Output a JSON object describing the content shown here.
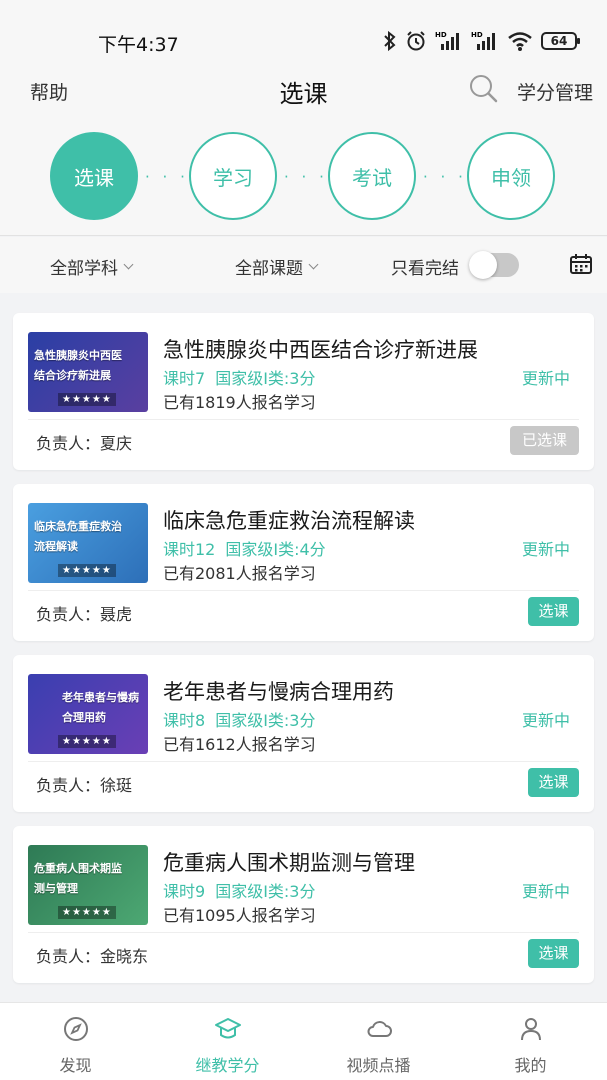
{
  "status_bar": {
    "time": "下午4:37",
    "battery": "64"
  },
  "header": {
    "help": "帮助",
    "title": "选课",
    "credit_management": "学分管理"
  },
  "steps": [
    "选课",
    "学习",
    "考试",
    "申领"
  ],
  "step_separator": "· · ·",
  "filters": {
    "subject": "全部学科",
    "topic": "全部课题",
    "finished_only": "只看完结",
    "finished_only_on": false
  },
  "courses": [
    {
      "title": "急性胰腺炎中西医结合诊疗新进展",
      "hours": "课时7",
      "credit": "国家级I类:3分",
      "enrolled": "已有1819人报名学习",
      "status": "更新中",
      "owner": "负责人：夏庆",
      "action": "已选课",
      "thumb_text": "急性胰腺炎中西医结合诊疗新进展",
      "thumb_stars": "★★★★★",
      "thumb_color": "#2a3fa5"
    },
    {
      "title": "临床急危重症救治流程解读",
      "hours": "课时12",
      "credit": "国家级I类:4分",
      "enrolled": "已有2081人报名学习",
      "status": "更新中",
      "owner": "负责人：聂虎",
      "action": "选课",
      "thumb_text": "临床急危重症救治流程解读",
      "thumb_stars": "★★★★★",
      "thumb_color": "#3d8fd6"
    },
    {
      "title": "老年患者与慢病合理用药",
      "hours": "课时8",
      "credit": "国家级I类:3分",
      "enrolled": "已有1612人报名学习",
      "status": "更新中",
      "owner": "负责人：徐珽",
      "action": "选课",
      "thumb_text": "老年患者与慢病合理用药",
      "thumb_stars": "★★★★★",
      "thumb_color": "#3a3fb0"
    },
    {
      "title": "危重病人围术期监测与管理",
      "hours": "课时9",
      "credit": "国家级I类:3分",
      "enrolled": "已有1095人报名学习",
      "status": "更新中",
      "owner": "负责人：金晓东",
      "action": "选课",
      "thumb_text": "危重病人围术期监测与管理",
      "thumb_stars": "★★★★★",
      "thumb_color": "#2e7a55"
    }
  ],
  "tabs": [
    {
      "label": "发现",
      "icon": "compass-icon"
    },
    {
      "label": "继教学分",
      "icon": "graduation-cap-icon"
    },
    {
      "label": "视频点播",
      "icon": "cloud-icon"
    },
    {
      "label": "我的",
      "icon": "person-icon"
    }
  ],
  "colors": {
    "accent": "#3fbfa8",
    "disabled": "#c8c8c8"
  }
}
